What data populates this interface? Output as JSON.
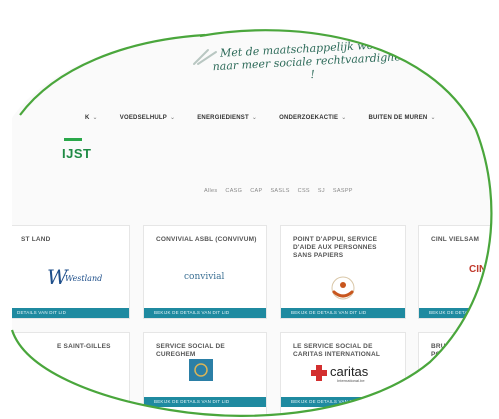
{
  "header": {
    "slogan_line1": "Met de maatschappelijk workers",
    "slogan_line2": "naar meer sociale rechtvaardigheid !"
  },
  "nav": {
    "items": [
      {
        "label": "K",
        "has_dropdown": true
      },
      {
        "label": "VOEDSELHULP",
        "has_dropdown": true
      },
      {
        "label": "ENERGIEDIENST",
        "has_dropdown": true
      },
      {
        "label": "ONDERZOEKACTIE",
        "has_dropdown": true
      },
      {
        "label": "BUITEN DE MUREN",
        "has_dropdown": true
      }
    ],
    "dropdown_glyph": "⌄"
  },
  "page": {
    "title": "IJST",
    "accent_color": "#2aa84a"
  },
  "filters": [
    "Alles",
    "CASG",
    "CAP",
    "SASLS",
    "CSS",
    "SJ",
    "SASPP"
  ],
  "cards": [
    {
      "name": "ST LAND",
      "logo": "westland-logo",
      "logo_text": "Westland",
      "button": "DETAILS VAN DIT LID"
    },
    {
      "name": "CONVIVIAL ASBL (CONVIVUM)",
      "logo": "convivial-logo",
      "logo_text": "convivial",
      "button": "BEKIJK DE DETAILS VAN DIT LID"
    },
    {
      "name": "POINT D'APPUI, SERVICE D'AIDE AUX PERSONNES SANS PAPIERS",
      "logo": "point-dappui-logo",
      "logo_text": "",
      "button": "BEKIJK DE DETAILS VAN DIT LID"
    },
    {
      "name": "CINL VIELSAM",
      "logo": "cinl-logo",
      "logo_text": "CINL",
      "button": "BEKIJK DE DETAILS VA"
    },
    {
      "name": "E SAINT-GILLES",
      "logo": "",
      "logo_text": "",
      "button": ""
    },
    {
      "name": "SERVICE SOCIAL DE CUREGHEM",
      "logo": "cureghem-logo",
      "logo_text": "",
      "button": "BEKIJK DE DETAILS VAN DIT LID"
    },
    {
      "name": "LE SERVICE SOCIAL DE CARITAS INTERNATIONAL",
      "logo": "caritas-logo",
      "logo_text": "caritas",
      "logo_subtext": "International.be",
      "button": "BEKIJK DE DETAILS VAN DIT LID"
    },
    {
      "name": "BRUXEL PORT",
      "logo": "",
      "logo_text": "",
      "button": ""
    }
  ],
  "colors": {
    "lens_outline": "#4aa63c",
    "card_button": "#1f8aa0",
    "title_green": "#1f8a44"
  }
}
